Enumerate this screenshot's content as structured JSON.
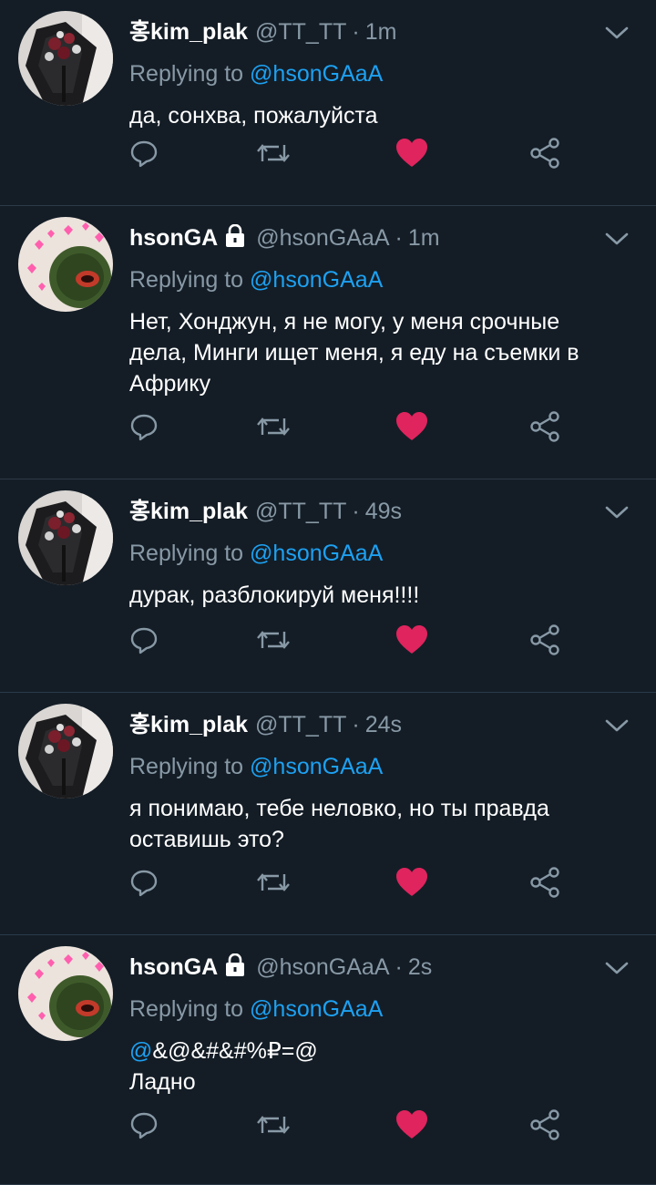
{
  "tweets": [
    {
      "name": "홍kim_plak",
      "locked": false,
      "handle": "@TT_TT",
      "time": "1m",
      "replying_prefix": "Replying to ",
      "replying_to": "@hsonGAaA",
      "lines": [
        "да, сонхва, пожалуйста"
      ],
      "liked": true,
      "avatar": "bouquet"
    },
    {
      "name": "hsonGA",
      "locked": true,
      "handle": "@hsonGAaA",
      "time": "1m",
      "replying_prefix": "Replying to ",
      "replying_to": "@hsonGAaA",
      "lines": [
        "Нет, Хонджун, я не могу, у меня срочные",
        "дела, Минги ищет меня, я еду на съемки в",
        "Африку"
      ],
      "liked": true,
      "avatar": "hearts"
    },
    {
      "name": "홍kim_plak",
      "locked": false,
      "handle": "@TT_TT",
      "time": "49s",
      "replying_prefix": "Replying to ",
      "replying_to": "@hsonGAaA",
      "lines": [
        "дурак, разблокируй меня!!!!"
      ],
      "liked": true,
      "avatar": "bouquet"
    },
    {
      "name": "홍kim_plak",
      "locked": false,
      "handle": "@TT_TT",
      "time": "24s",
      "replying_prefix": "Replying to ",
      "replying_to": "@hsonGAaA",
      "lines": [
        "я понимаю, тебе неловко, но ты правда",
        "оставишь это?"
      ],
      "liked": true,
      "avatar": "bouquet"
    },
    {
      "name": "hsonGA",
      "locked": true,
      "handle": "@hsonGAaA",
      "time": "2s",
      "replying_prefix": "Replying to ",
      "replying_to": "@hsonGAaA",
      "body_mention": "@",
      "lines": [
        "&@&#&#%₽=@",
        "Ладно"
      ],
      "liked": true,
      "avatar": "hearts"
    }
  ],
  "dot": "·",
  "icons": {
    "reply": "reply-icon",
    "retweet": "retweet-icon",
    "like": "heart-icon",
    "share": "share-icon",
    "menu": "chevron-down-icon",
    "lock": "lock-icon"
  },
  "colors": {
    "background": "#141d26",
    "link": "#1da1f2",
    "muted": "#8899a6",
    "like": "#e0245e",
    "divider": "#2c3a48"
  }
}
